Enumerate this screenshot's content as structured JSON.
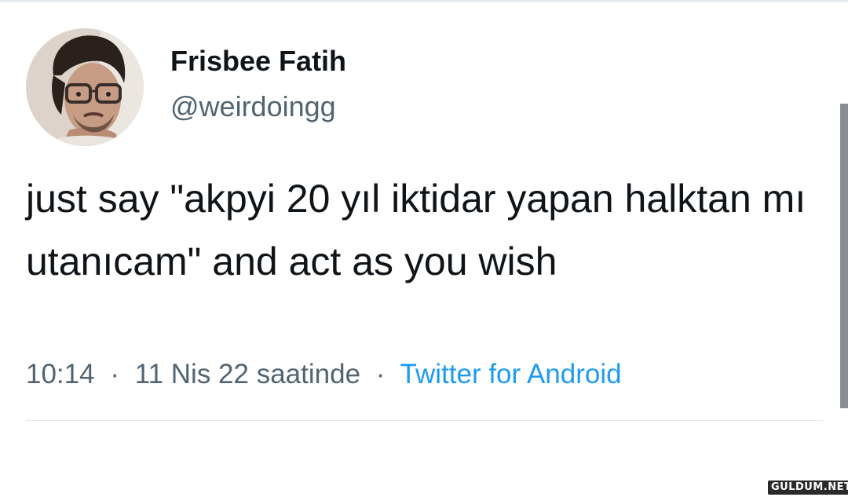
{
  "tweet": {
    "author": {
      "display_name": "Frisbee Fatih",
      "handle": "@weirdoingg",
      "avatar_icon": "user-avatar-photo"
    },
    "text": "just say \"akpyi 20 yıl iktidar yapan halktan mı utanıcam\" and act as you wish",
    "time": "10:14",
    "separator": "·",
    "date": "11 Nis 22 saatinde",
    "source": "Twitter for Android"
  },
  "watermark": {
    "text": "GULDUM.NET"
  },
  "colors": {
    "text_primary": "#0f1419",
    "text_secondary": "#536471",
    "link": "#1d9bf0",
    "divider": "#dfe8ee"
  }
}
